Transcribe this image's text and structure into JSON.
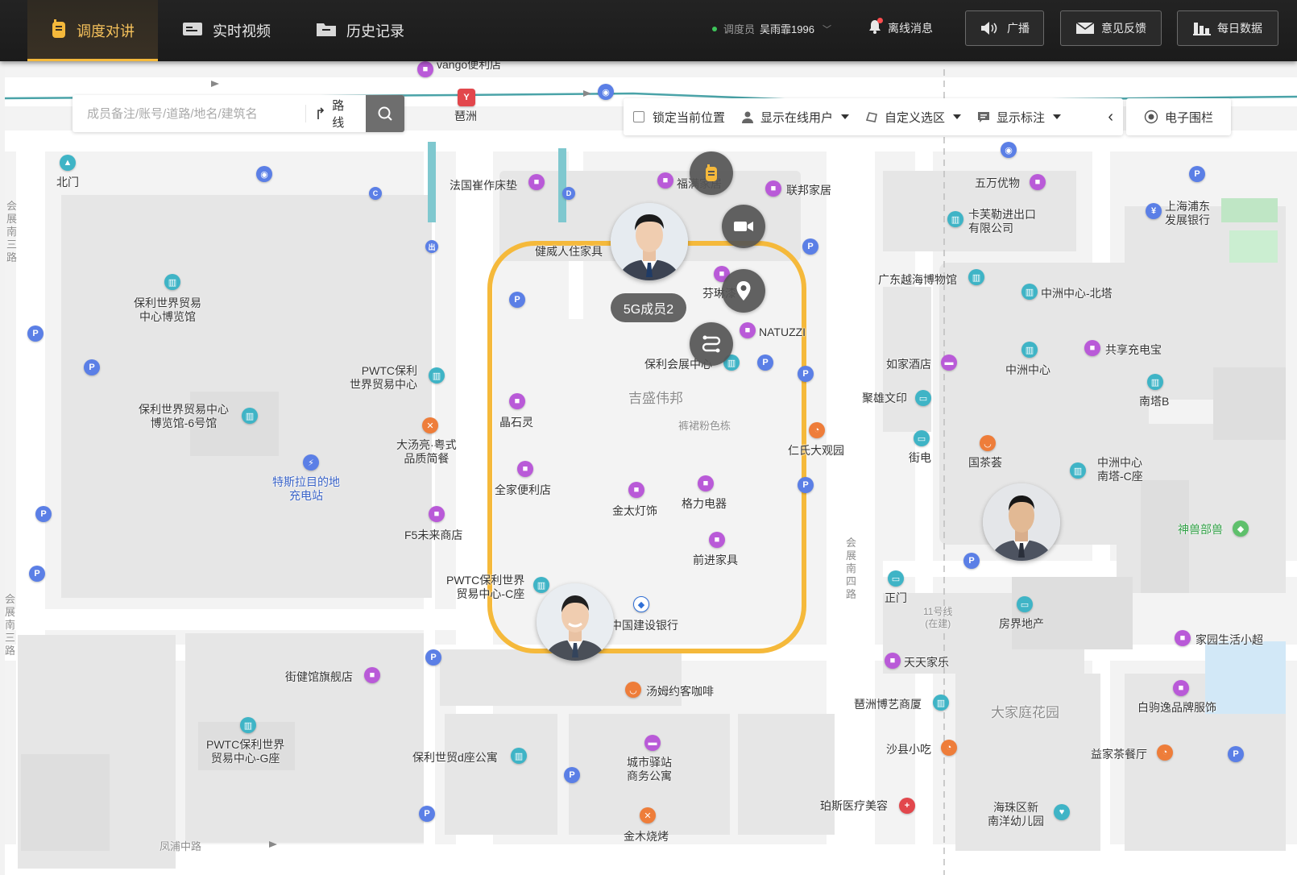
{
  "nav": {
    "tabs": [
      {
        "label": "调度对讲",
        "icon": "talk-icon",
        "active": true
      },
      {
        "label": "实时视频",
        "icon": "video-screen-icon",
        "active": false
      },
      {
        "label": "历史记录",
        "icon": "folder-icon",
        "active": false
      }
    ]
  },
  "user": {
    "role": "调度员",
    "name": "吴雨霏1996",
    "status_color": "#3ec45a"
  },
  "offline_messages": "离线消息",
  "top_buttons": {
    "broadcast": "广播",
    "feedback": "意见反馈",
    "daily_data": "每日数据"
  },
  "search": {
    "placeholder": "成员备注/账号/道路/地名/建筑名",
    "value": "",
    "route_label": "路线"
  },
  "toolbar": {
    "lock_position": "锁定当前位置",
    "show_online_users": "显示在线用户",
    "custom_area": "自定义选区",
    "show_annotations": "显示标注",
    "geofence": "电子围栏"
  },
  "members": {
    "selected_label": "5G成员2"
  },
  "accent_color": "#f5b93b",
  "fence_color": "#f5b93b",
  "map": {
    "labels": {
      "vango": "vango便利店",
      "pazhou_station": "琶洲",
      "beimen": "北门",
      "zhanzhan3": "会展南三路",
      "poly_expo": "保利世界贸易\n中心博览馆",
      "poly_expo6": "保利世界贸易中心\n博览馆-6号馆",
      "pwtc": "PWTC保利\n世界贸易中心",
      "tesla": "特斯拉目的地\n充电站",
      "datang": "大汤亮·粤式\n品质简餐",
      "f5": "F5未来商店",
      "pwtc_c": "PWTC保利世界\n贸易中心-C座",
      "jiejian": "街健馆旗舰店",
      "pwtc_g": "PWTC保利世界\n贸易中心-G座",
      "poly_d": "保利世贸d座公寓",
      "fengpu": "凤浦中路",
      "fachui": "法国崔作床垫",
      "fuman": "福满家居",
      "lianbang": "联邦家居",
      "jianwei": "健威人住家具",
      "fenlin": "芬琳漆",
      "natuzzi": "NATUZZI",
      "poly_hall": "保利会展中心",
      "jisheng": "吉盛伟邦",
      "qunku": "裤裙粉色栋",
      "jingshiling": "晶石灵",
      "quanjia": "全家便利店",
      "jintai": "金太灯饰",
      "geli": "格力电器",
      "qianjin": "前进家具",
      "ccb": "中国建设银行",
      "tangmu": "汤姆约客咖啡",
      "chengshi": "城市驿站\n商务公寓",
      "jinmu": "金木烧烤",
      "renshi": "仁氏大观园",
      "wanwan": "五万优物",
      "kafu": "卡芙勒进出口\n有限公司",
      "spdb": "上海浦东\n发展银行",
      "guangdong": "广东越海博物馆",
      "zhongzhou_n": "中洲中心-北塔",
      "rujia": "如家酒店",
      "zhongzhou": "中洲中心",
      "gongxiang": "共享充电宝",
      "juxiong": "聚雄文印",
      "nanta_b": "南塔B",
      "jiedian": "街电",
      "guocha": "国茶荟",
      "zhongzhou_c": "中洲中心\n南塔-C座",
      "shenshou": "神兽部兽",
      "zhanzhan4": "会展南四路",
      "zhengmen": "正门",
      "line11": "11号线\n(在建)",
      "fangjie": "房界地产",
      "jiayuan": "家园生活小超",
      "tiantian": "天天家乐",
      "pazhou_bo": "琶洲博艺商厦",
      "dajiating": "大家庭花园",
      "baiju": "白驹逸品牌服饰",
      "shaxian": "沙县小吃",
      "yijia": "益家茶餐厅",
      "pasi": "珀斯医疗美容",
      "haizhu": "海珠区新\n南洋幼儿园",
      "zhanzhan_left": "会展南三路"
    }
  }
}
